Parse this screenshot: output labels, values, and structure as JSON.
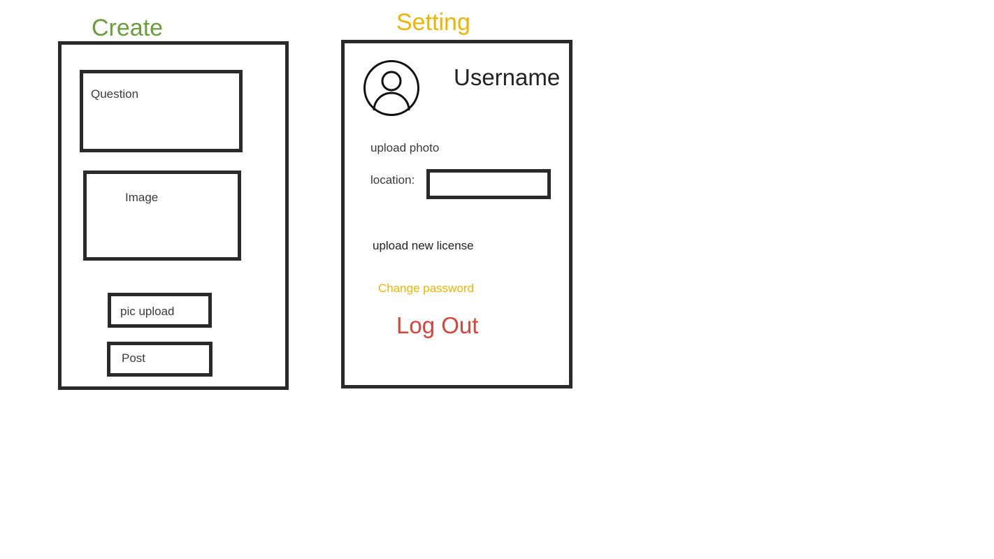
{
  "colors": {
    "create_title": "#6a9e3a",
    "setting_title": "#f0b400",
    "change_password": "#f0b400",
    "log_out": "#d8433a",
    "frame": "#2a2a2a",
    "text": "#3a3a3a"
  },
  "create": {
    "title": "Create",
    "question_label": "Question",
    "image_label": "Image",
    "pic_upload_label": "pic upload",
    "post_label": "Post"
  },
  "setting": {
    "title": "Setting",
    "avatar_icon": "user-avatar-icon",
    "username": "Username",
    "upload_photo": "upload photo",
    "location_label": "location:",
    "location_value": "",
    "upload_license": "upload new license",
    "change_password": "Change password",
    "log_out": "Log Out"
  }
}
